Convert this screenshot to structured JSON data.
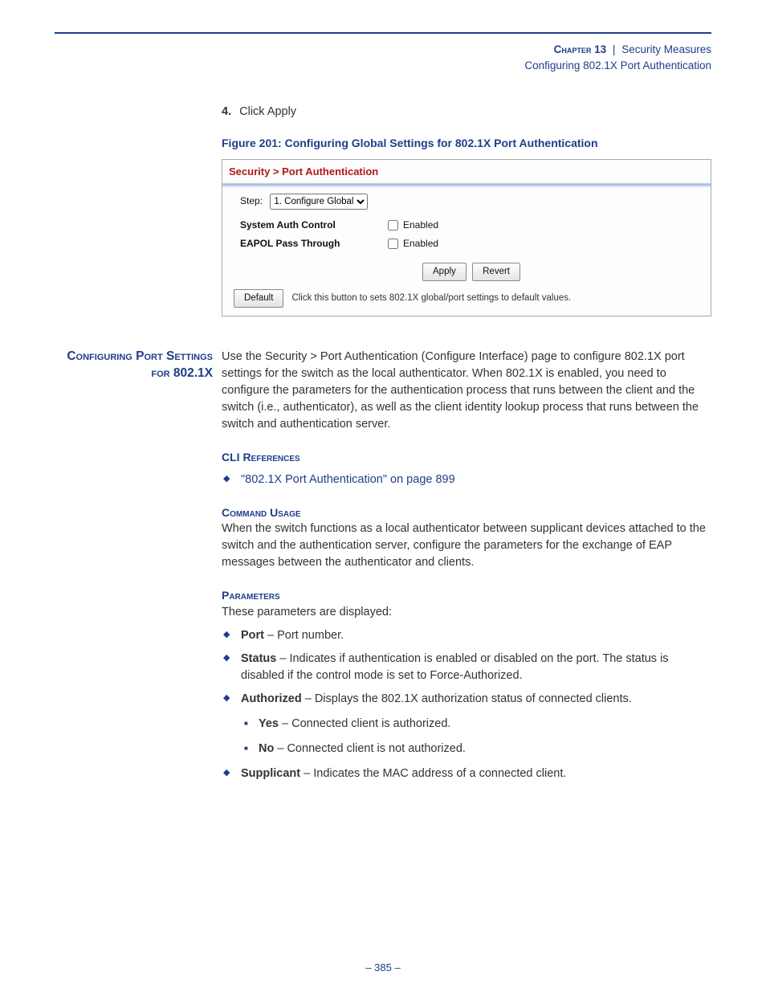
{
  "header": {
    "chapter": "Chapter 13",
    "title": "Security Measures",
    "subtitle": "Configuring 802.1X Port Authentication"
  },
  "step": {
    "num": "4.",
    "text": "Click Apply"
  },
  "figure_caption": "Figure 201:  Configuring Global Settings for 802.1X Port Authentication",
  "sshot": {
    "title": "Security > Port Authentication",
    "step_label": "Step:",
    "step_value": "1. Configure Global",
    "row1_label": "System Auth Control",
    "row1_chk": "Enabled",
    "row2_label": "EAPOL Pass Through",
    "row2_chk": "Enabled",
    "btn_apply": "Apply",
    "btn_revert": "Revert",
    "btn_default": "Default",
    "hint": "Click this button to sets 802.1X global/port settings to default values."
  },
  "section": {
    "margin_heading": "Configuring Port Settings for 802.1X",
    "intro": "Use the Security > Port Authentication (Configure Interface) page to configure 802.1X port settings for the switch as the local authenticator. When 802.1X is enabled, you need to configure the parameters for the authentication process that runs between the client and the switch (i.e., authenticator), as well as the client identity lookup process that runs between the switch and authentication server.",
    "cli_head": "CLI References",
    "cli_link": "\"802.1X Port Authentication\" on page 899",
    "cu_head": "Command Usage",
    "cu_text": "When the switch functions as a local authenticator between supplicant devices attached to the switch and the authentication server, configure the parameters for the exchange of EAP messages between the authenticator and clients.",
    "param_head": "Parameters",
    "param_intro": "These parameters are displayed:",
    "p_port_b": "Port",
    "p_port_t": " – Port number.",
    "p_status_b": "Status",
    "p_status_t": " – Indicates if authentication is enabled or disabled on the port. The status is disabled if the control mode is set to Force-Authorized.",
    "p_auth_b": "Authorized",
    "p_auth_t": " – Displays the 802.1X authorization status of connected clients.",
    "p_yes_b": "Yes",
    "p_yes_t": " – Connected client is authorized.",
    "p_no_b": "No",
    "p_no_t": " – Connected client is not authorized.",
    "p_supp_b": "Supplicant",
    "p_supp_t": " – Indicates the MAC address of a connected client."
  },
  "page_number": "–  385  –"
}
